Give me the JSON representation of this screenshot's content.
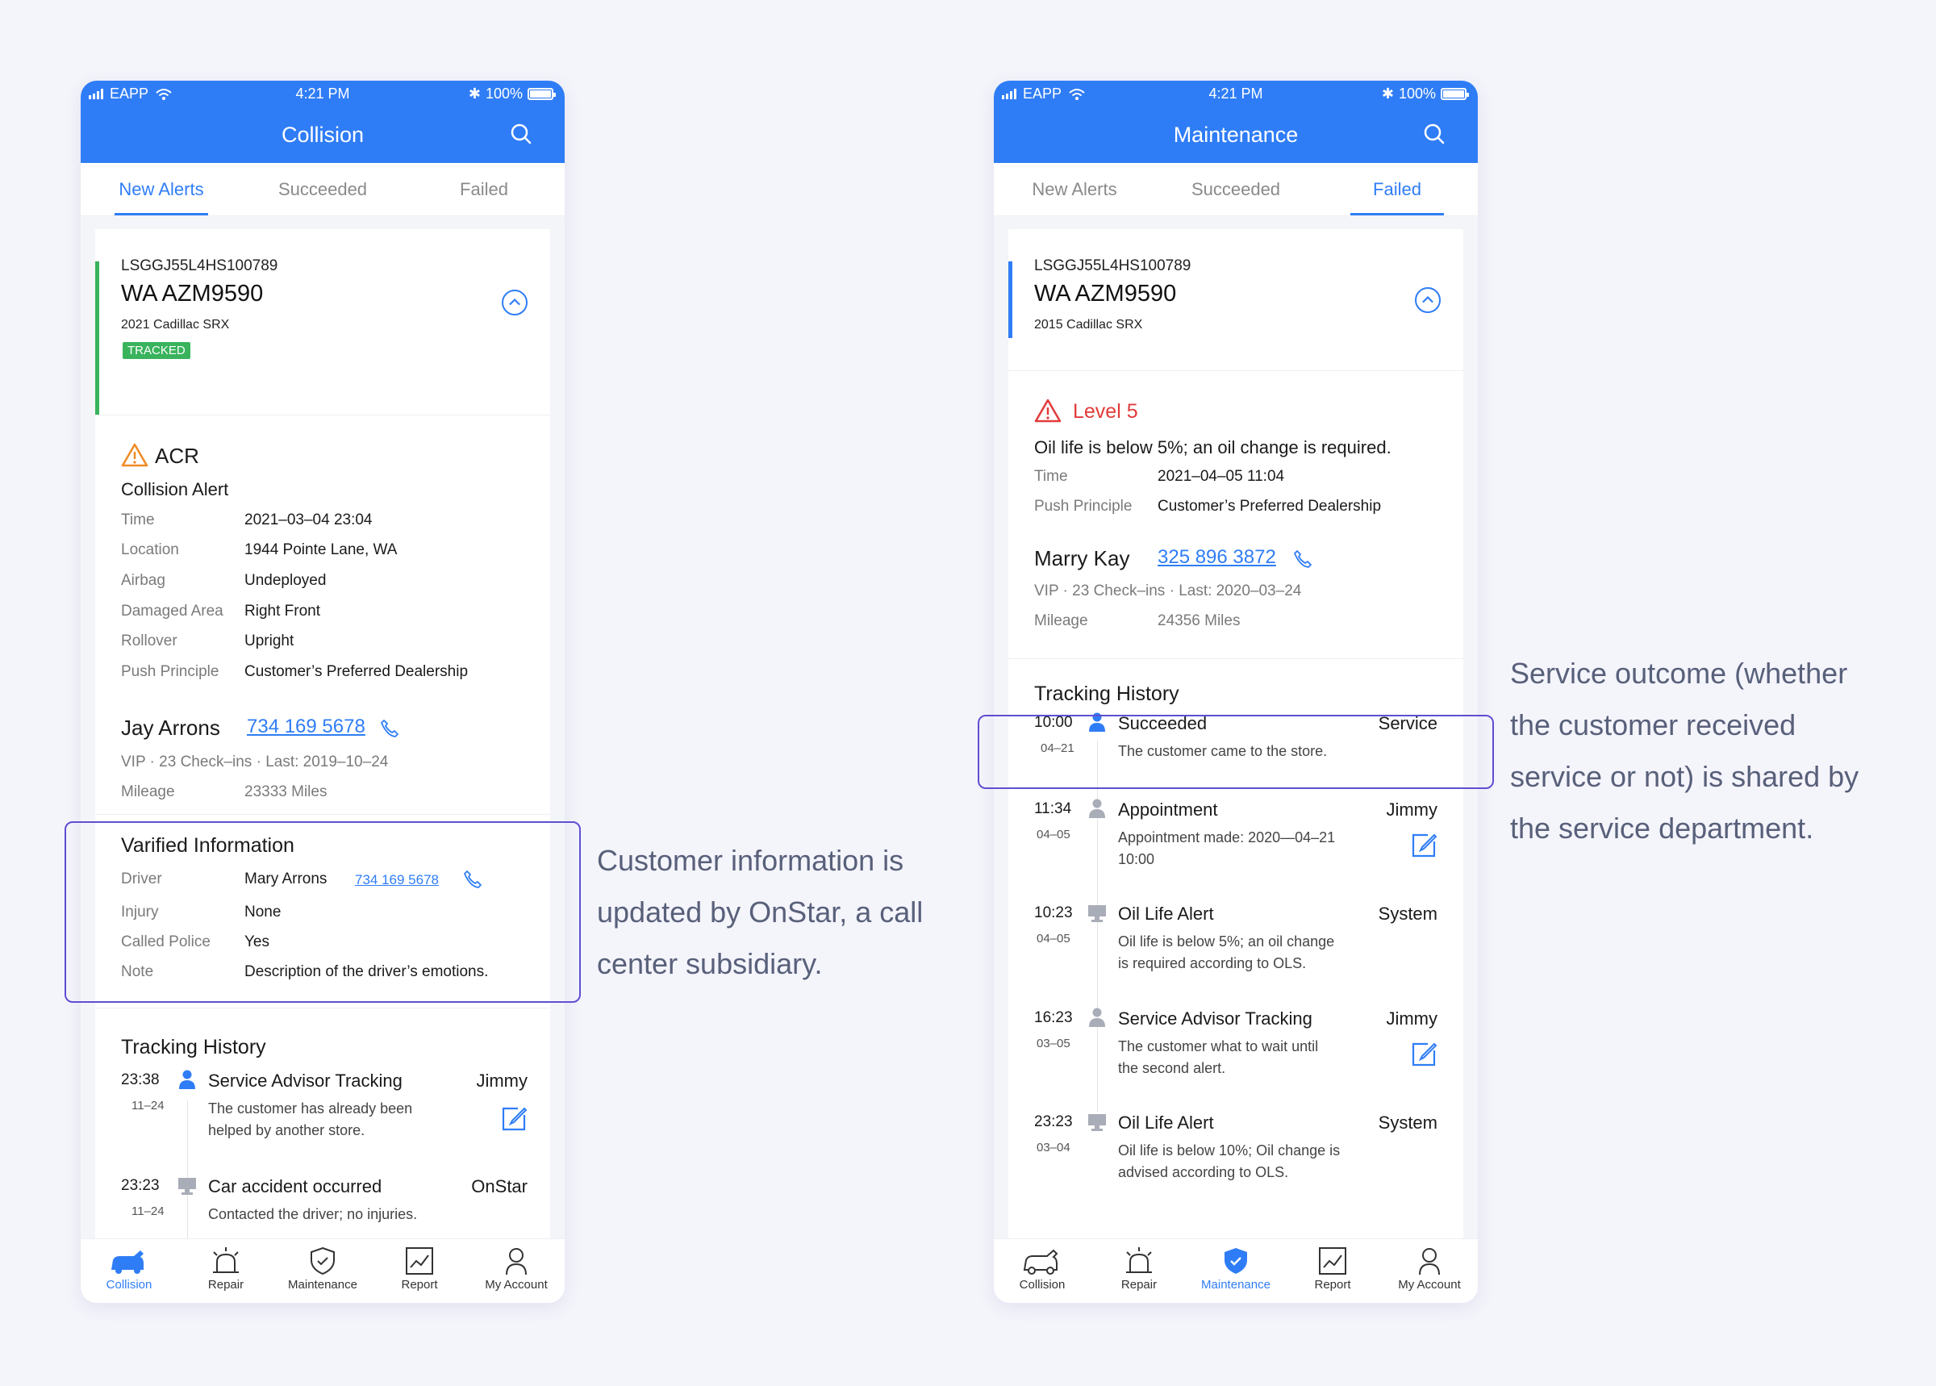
{
  "status_bar": {
    "carrier": "EAPP",
    "time": "4:21 PM",
    "battery": "100%",
    "battery_level": 1.0
  },
  "tab_labels": [
    "New Alerts",
    "Succeeded",
    "Failed"
  ],
  "nav_labels": [
    "Collision",
    "Repair",
    "Maintenance",
    "Report",
    "My Account"
  ],
  "colors": {
    "primary": "#2f7df6",
    "tracked": "#39b35c",
    "level_red": "#e23b3b",
    "annotation_box": "#5e4fd2",
    "annotation_text": "#58607a"
  },
  "left": {
    "title": "Collision",
    "vehicle": {
      "vin": "LSGGJ55L4HS100789",
      "plate": "WA AZM9590",
      "model": "2021 Cadillac SRX",
      "badge": "TRACKED"
    },
    "alert": {
      "code": "ACR",
      "name": "Collision Alert",
      "rows": [
        {
          "label": "Time",
          "value": "2021–03–04     23:04"
        },
        {
          "label": "Location",
          "value": "1944 Pointe Lane, WA"
        },
        {
          "label": "Airbag",
          "value": "Undeployed"
        },
        {
          "label": "Damaged Area",
          "value": "Right Front"
        },
        {
          "label": "Rollover",
          "value": "Upright"
        },
        {
          "label": "Push Principle",
          "value": "Customer’s Preferred Dealership"
        }
      ]
    },
    "customer": {
      "name": "Jay Arrons",
      "phone": "734 169 5678",
      "vip": "VIP",
      "checkins": "23 Check–ins",
      "last": "Last: 2019–10–24",
      "mileage_label": "Mileage",
      "mileage": "23333 Miles"
    },
    "verified": {
      "title": "Varified Information",
      "rows": [
        {
          "label": "Driver",
          "value": "Mary Arrons",
          "phone": "734 169 5678"
        },
        {
          "label": "Injury",
          "value": "None"
        },
        {
          "label": "Called Police",
          "value": "Yes"
        },
        {
          "label": "Note",
          "value": "Description of the driver’s emotions."
        }
      ]
    },
    "history": {
      "title": "Tracking History",
      "items": [
        {
          "time": "23:38",
          "date": "11–24",
          "title": "Service Advisor Tracking",
          "right": "Jimmy",
          "desc": [
            "The customer has already been",
            "helped by another store."
          ]
        },
        {
          "time": "23:23",
          "date": "11–24",
          "title": "Car accident occurred",
          "right": "OnStar",
          "desc": [
            "Contacted the driver; no injuries."
          ]
        }
      ]
    },
    "annotation": [
      "Customer information is",
      "updated by OnStar, a call",
      "center subsidiary."
    ]
  },
  "right": {
    "title": "Maintenance",
    "vehicle": {
      "vin": "LSGGJ55L4HS100789",
      "plate": "WA AZM9590",
      "model": "2015 Cadillac SRX"
    },
    "alert": {
      "level": "Level 5",
      "message": "Oil life is below 5%; an oil change is required.",
      "rows": [
        {
          "label": "Time",
          "value": "2021–04–05     11:04"
        },
        {
          "label": "Push Principle",
          "value": "Customer’s Preferred Dealership"
        }
      ]
    },
    "customer": {
      "name": "Marry Kay",
      "phone": "325 896 3872",
      "vip": "VIP",
      "checkins": "23 Check–ins",
      "last": "Last: 2020–03–24",
      "mileage_label": "Mileage",
      "mileage": "24356 Miles"
    },
    "history": {
      "title": "Tracking History",
      "items": [
        {
          "time": "10:00",
          "date": "04–21",
          "title": "Succeeded",
          "right": "Service",
          "desc": [
            "The customer came to the store."
          ]
        },
        {
          "time": "11:34",
          "date": "04–05",
          "title": "Appointment",
          "right": "Jimmy",
          "desc": [
            "Appointment made: 2020—04–21",
            "10:00"
          ]
        },
        {
          "time": "10:23",
          "date": "04–05",
          "title": "Oil Life Alert",
          "right": "System",
          "desc": [
            "Oil life is below 5%; an oil change",
            "is required according to OLS."
          ]
        },
        {
          "time": "16:23",
          "date": "03–05",
          "title": "Service Advisor Tracking",
          "right": "Jimmy",
          "desc": [
            "The customer what to wait until",
            "the second alert."
          ]
        },
        {
          "time": "23:23",
          "date": "03–04",
          "title": "Oil Life Alert",
          "right": "System",
          "desc": [
            "Oil life is below 10%; Oil change is",
            "advised according to OLS."
          ]
        }
      ]
    },
    "annotation": [
      "Service outcome (whether",
      "the customer received",
      "service or not) is shared by",
      "the service department."
    ]
  }
}
